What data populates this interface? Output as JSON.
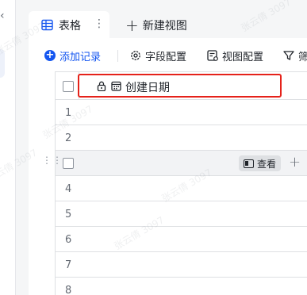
{
  "tabs": [
    {
      "label": "表格",
      "icon": "table-grid-icon",
      "active": true
    },
    {
      "label": "新建视图",
      "icon": "plus-icon",
      "active": false
    }
  ],
  "toolbar": {
    "add_record": "添加记录",
    "field_config": "字段配置",
    "view_config": "视图配置",
    "filter": "筛"
  },
  "table": {
    "column_name": "创建日期",
    "rows": [
      {
        "number": "1"
      },
      {
        "number": "2"
      },
      {
        "number": ""
      },
      {
        "number": "4"
      },
      {
        "number": "5"
      },
      {
        "number": "6"
      },
      {
        "number": "7"
      },
      {
        "number": "8"
      }
    ],
    "row_view_button": "查看"
  },
  "watermark": "张云倩 3097",
  "colors": {
    "accent": "#1456f0",
    "highlight": "#e5221a",
    "border": "#dee0e3"
  }
}
